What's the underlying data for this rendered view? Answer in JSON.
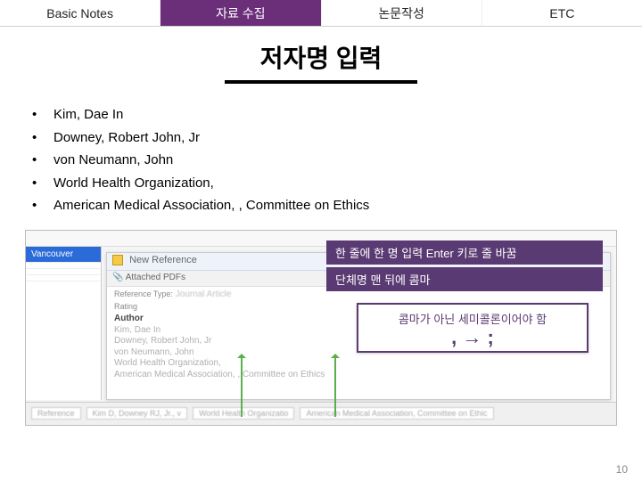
{
  "tabs": {
    "t0": "Basic Notes",
    "t1": "자료 수집",
    "t2": "논문작성",
    "t3": "ETC"
  },
  "title": "저자명 입력",
  "bullets": {
    "b0": "Kim, Dae In",
    "b1": "Downey, Robert John, Jr",
    "b2": "von Neumann, John",
    "b3": "World Health Organization,",
    "b4": "American Medical Association, , Committee on Ethics"
  },
  "shot": {
    "leftItems": {
      "i0": "Vancouver"
    },
    "newRefTitle": "New Reference",
    "attachedTab": "Attached PDFs",
    "refTypeLabel": "Reference Type:",
    "refTypeVal": "Journal Article",
    "ratingLabel": "Rating",
    "authorLabel": "Author",
    "authors": {
      "a0": "Kim, Dae In",
      "a1": "Downey, Robert John, Jr",
      "a2": "von Neumann, John",
      "a3": "World Health Organization,",
      "a4": "American Medical Association, , Committee on Ethics"
    },
    "bottom": {
      "c0": "Reference",
      "c1": "Kim D, Downey RJ, Jr., v",
      "c2": "World Health Organizatio",
      "c3": "American Medical Association, Committee on Ethic"
    }
  },
  "callout1": {
    "l1": "한 줄에 한 명 입력 Enter 키로 줄 바꿈",
    "l2": "단체명 맨 뒤에 콤마"
  },
  "callout2": {
    "l1": "콤마가 아닌 세미콜론이어야 함",
    "l2": ", → ;"
  },
  "page": "10"
}
